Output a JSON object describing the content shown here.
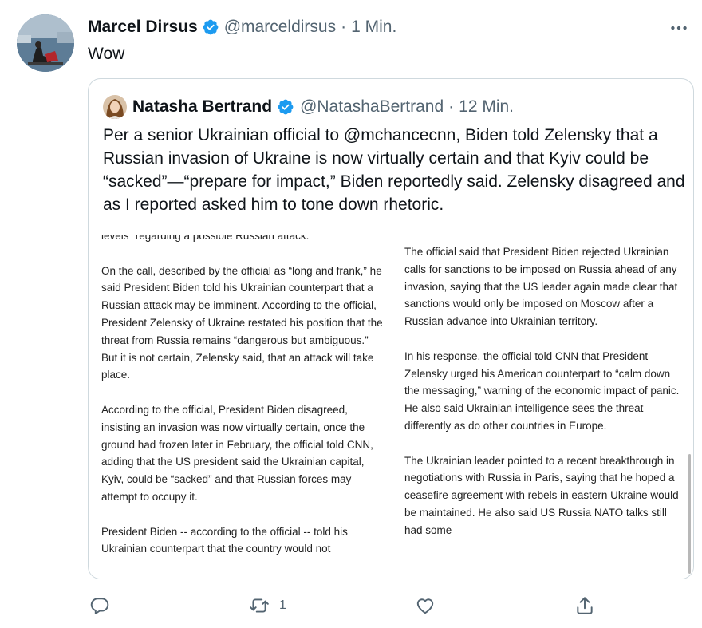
{
  "tweet": {
    "author_name": "Marcel Dirsus",
    "handle": "@marceldirsus",
    "separator": "·",
    "time": "1 Min.",
    "text": "Wow"
  },
  "quoted": {
    "author_name": "Natasha Bertrand",
    "handle": "@NatashaBertrand",
    "separator": "·",
    "time": "12 Min.",
    "text": "Per a senior Ukrainian official to @mchancecnn, Biden told Zelensky that a Russian invasion of Ukraine is now virtually certain and that Kyiv could be “sacked”—“prepare for impact,” Biden reportedly said. Zelensky disagreed and as I reported asked him to tone down rhetoric.",
    "image": {
      "left_top_fragment": "levels” regarding a possible Russian attack.",
      "left_paragraphs": [
        "On the call, described by the official as “long and frank,” he said President Biden told his Ukrainian counterpart that a Russian attack may be imminent. According to the official, President Zelensky of Ukraine restated his position that the threat from Russia remains “dangerous but ambiguous.” But it is not certain, Zelensky said, that an attack will take place.",
        "According to the official, President Biden disagreed, insisting an invasion was now virtually certain, once the ground had frozen later in February, the official told CNN, adding that the US president said the Ukrainian capital, Kyiv,  could be “sacked” and that Russian forces may attempt to occupy it.",
        "President Biden -- according to the official -- told his Ukrainian counterpart that the country would not"
      ],
      "right_paragraphs": [
        "The official said that President Biden rejected Ukrainian calls for sanctions to be imposed on Russia ahead of any invasion, saying that the US leader again made clear that sanctions would only be imposed on Moscow after a Russian advance into Ukrainian territory.",
        "In his response, the official told CNN that President Zelensky urged his American counterpart to “calm down the messaging,” warning of the economic impact of panic. He also said Ukrainian intelligence sees the threat differently as do other countries in Europe.",
        "The Ukrainian leader pointed to a recent breakthrough in negotiations with Russia in Paris, saying that he hoped a ceasefire agreement with rebels in eastern Ukraine would be maintained. He also said US Russia NATO talks still had some"
      ]
    }
  },
  "actions": {
    "reply_count": "",
    "retweet_count": "1",
    "like_count": ""
  },
  "colors": {
    "verified": "#1d9bf0",
    "secondary_text": "#536471",
    "border": "#cfd9de"
  },
  "icons": [
    "verified-icon",
    "more-icon",
    "reply-icon",
    "retweet-icon",
    "like-icon",
    "share-icon"
  ]
}
